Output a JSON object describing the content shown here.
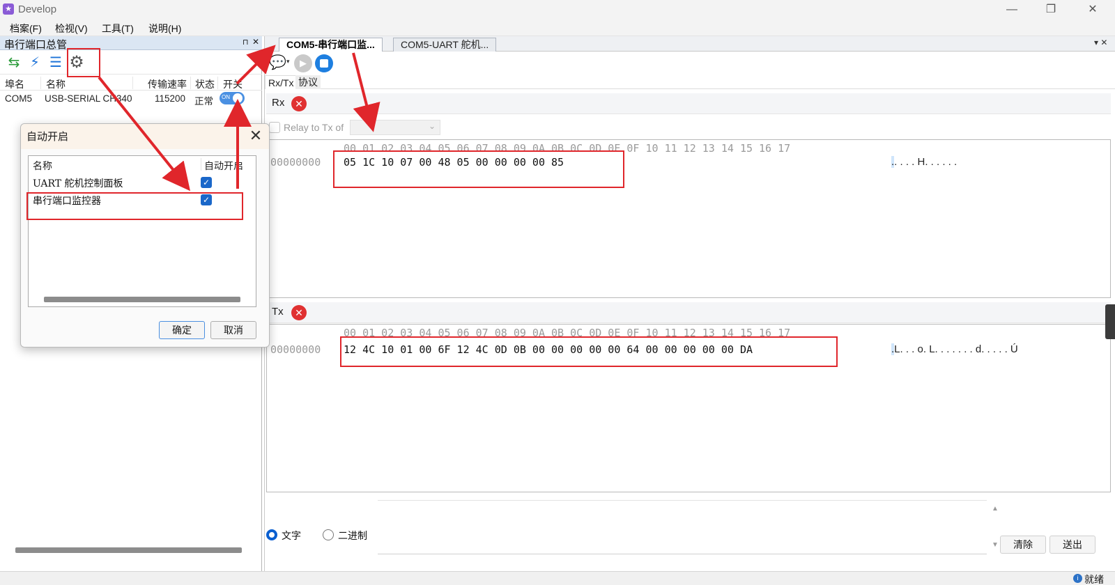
{
  "window": {
    "title": "Develop",
    "controls": {
      "minimize": "—",
      "maximize": "❐",
      "close": "✕"
    }
  },
  "menu": [
    "档案(F)",
    "检视(V)",
    "工具(T)",
    "说明(H)"
  ],
  "left_panel": {
    "title": "串行端口总管",
    "pin": "⊓",
    "close": "✕",
    "toolbar_icons": [
      "refresh-icon",
      "connect-plug-icon",
      "list-icon",
      "gear-icon"
    ],
    "columns": [
      "埠名",
      "名称",
      "传输速率",
      "状态",
      "开关"
    ],
    "rows": [
      {
        "port": "COM5",
        "name": "USB-SERIAL CH340",
        "rate": "115200",
        "status": "正常",
        "switch": "ON"
      }
    ]
  },
  "dialog": {
    "title": "自动开启",
    "columns": [
      "名称",
      "自动开启"
    ],
    "items": [
      {
        "name": "UART 舵机控制面板",
        "checked": true
      },
      {
        "name": "串行端口监控器",
        "checked": true
      }
    ],
    "ok": "确定",
    "cancel": "取消"
  },
  "right_panel": {
    "tabs": [
      "COM5-串行端口监...",
      "COM5-UART 舵机..."
    ],
    "tab_menu": "▾ ✕",
    "subtabs": [
      "Rx/Tx",
      "协议"
    ],
    "rx": {
      "label": "Rx",
      "relay_label": "Relay to Tx of",
      "header": "00 01 02 03 04 05 06 07 08 09 0A 0B 0C 0D 0E 0F 10 11 12 13 14 15 16 17",
      "address": "00000000",
      "bytes": "05 1C 10 07 00 48 05 00 00 00 00 85",
      "ascii_first": ".",
      "ascii_rest": ". . . . H. . . . . ."
    },
    "tx": {
      "label": "Tx",
      "header": "00 01 02 03 04 05 06 07 08 09 0A 0B 0C 0D 0E 0F 10 11 12 13 14 15 16 17",
      "address": "00000000",
      "bytes": "12 4C 10 01 00 6F 12 4C 0D 0B 00 00 00 00 00 64 00 00 00 00 00 DA",
      "ascii_first": ".",
      "ascii_rest": "L. . . o. L. . . . . . . d. . . . . Ú"
    },
    "send": {
      "mode_text": "文字",
      "mode_binary": "二进制",
      "clear": "清除",
      "send": "送出"
    }
  },
  "status": {
    "text": "就绪"
  },
  "colors": {
    "accent": "#0a5fd0",
    "highlight": "#e0262b",
    "error": "#e03131"
  }
}
